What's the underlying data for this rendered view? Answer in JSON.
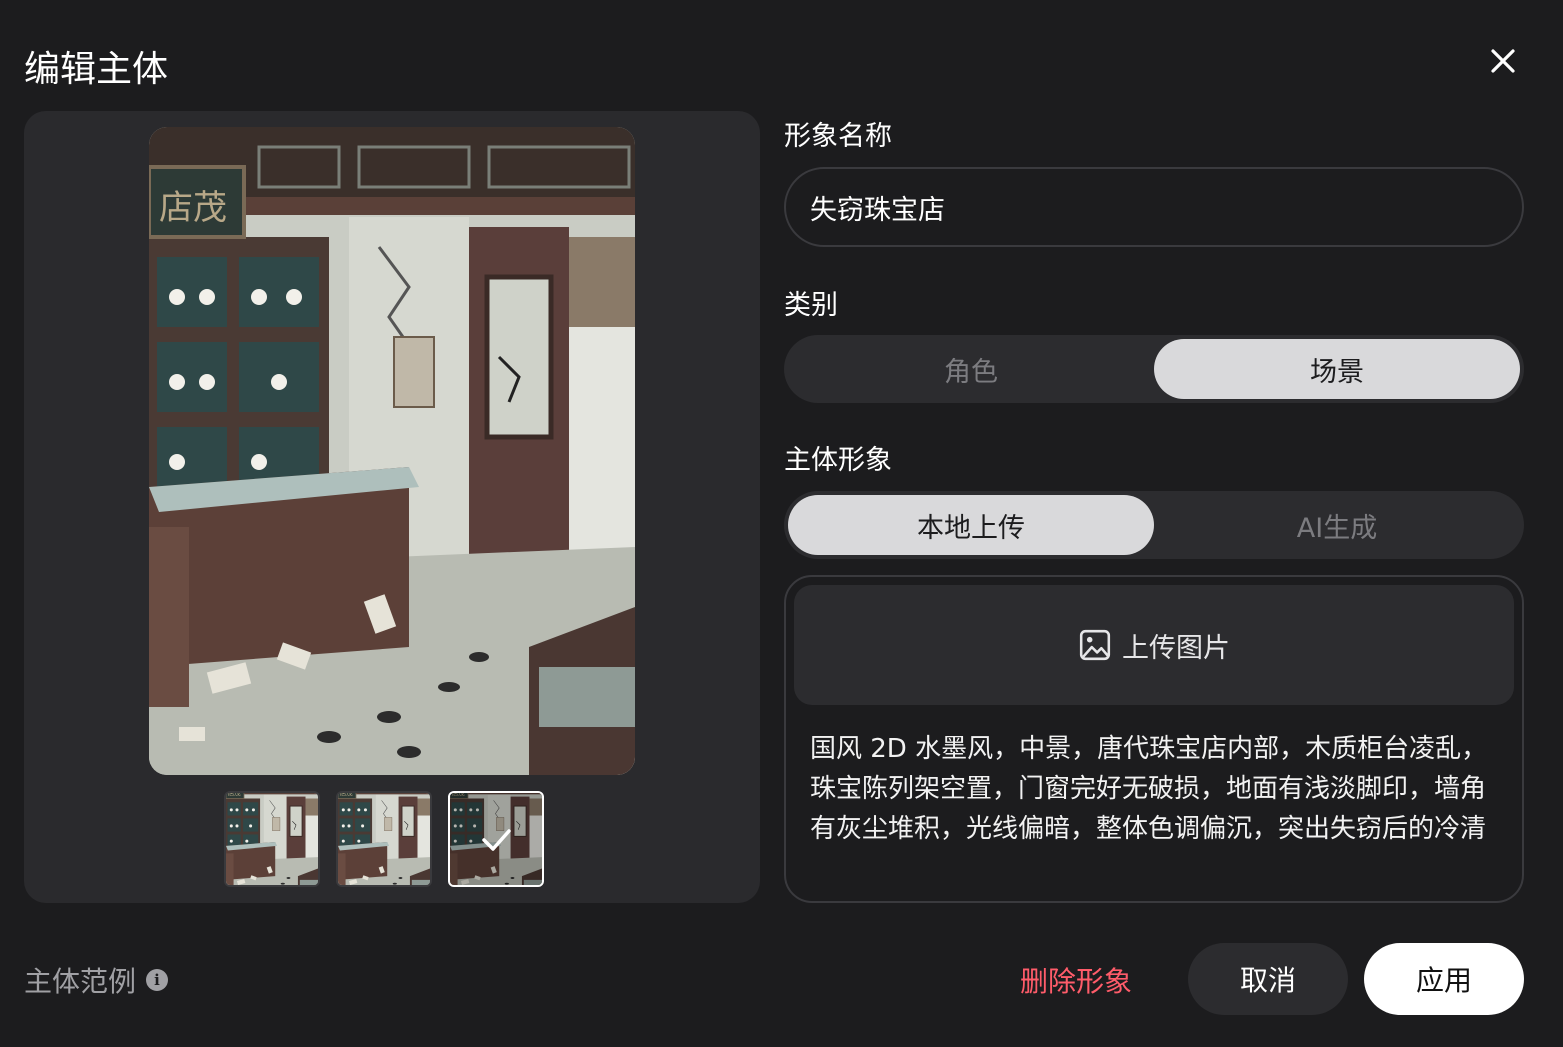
{
  "dialog": {
    "title": "编辑主体"
  },
  "form": {
    "name_label": "形象名称",
    "name_value": "失窃珠宝店",
    "category_label": "类别",
    "category_options": [
      "角色",
      "场景"
    ],
    "category_selected": "场景",
    "image_label": "主体形象",
    "image_source_options": [
      "本地上传",
      "AI生成"
    ],
    "image_source_selected": "本地上传",
    "upload_label": "上传图片",
    "prompt": "国风 2D 水墨风，中景，唐代珠宝店内部，木质柜台凌乱，珠宝陈列架空置，门窗完好无破损，地面有浅淡脚印，墙角有灰尘堆积，光线偏暗，整体色调偏沉，突出失窃后的冷清"
  },
  "preview": {
    "thumbnail_count": 3,
    "selected_thumbnail": 3
  },
  "footer": {
    "example_label": "主体范例",
    "delete_label": "删除形象",
    "cancel_label": "取消",
    "apply_label": "应用"
  },
  "colors": {
    "background": "#1c1c1e",
    "panel": "#2a2a2d",
    "segment_active": "#d9d9db",
    "delete": "#ff5c6a",
    "apply_bg": "#ffffff"
  },
  "icons": {
    "close": "close-icon",
    "upload": "image-icon",
    "info": "info-icon",
    "check": "check-icon"
  }
}
